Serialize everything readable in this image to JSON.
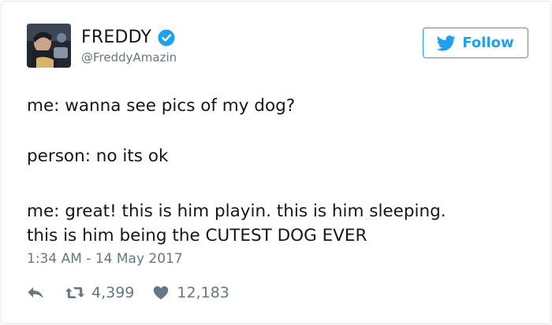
{
  "tweet": {
    "display_name": "FREDDY",
    "handle": "@FreddyAmazin",
    "follow_label": "Follow",
    "lines": [
      "me: wanna see pics of my dog?",
      "person: no its ok",
      "me: great! this is him playin. this is him sleeping.",
      "this is him being the CUTEST DOG EVER"
    ],
    "timestamp": "1:34 AM - 14 May 2017",
    "retweets": "4,399",
    "likes": "12,183"
  },
  "icons": {
    "verified": "verified-badge-icon",
    "bird": "twitter-bird-icon",
    "reply": "reply-arrow-icon",
    "retweet": "retweet-icon",
    "like": "heart-icon"
  },
  "colors": {
    "accent": "#1da1f2",
    "muted": "#657786",
    "text": "#14171a"
  }
}
